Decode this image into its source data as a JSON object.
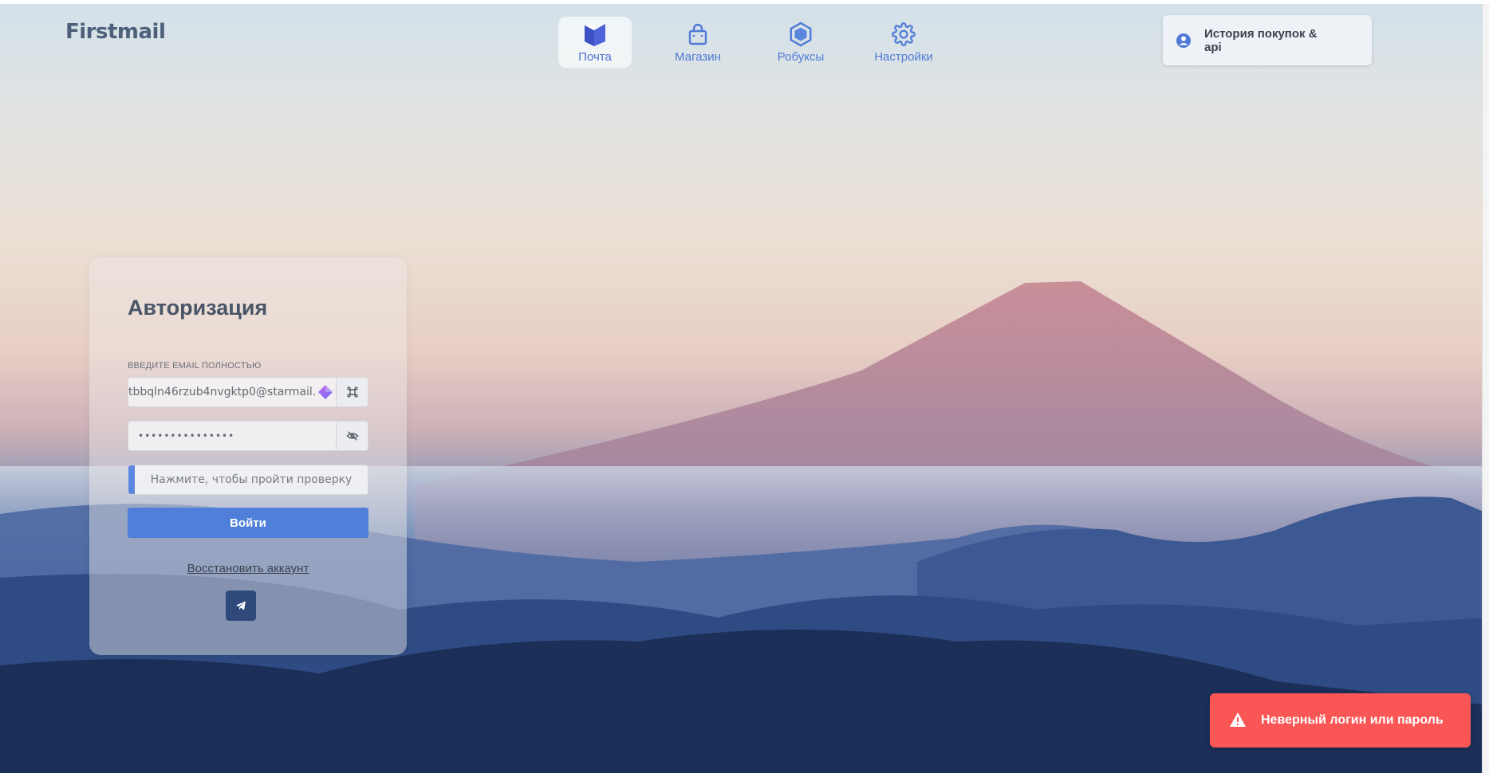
{
  "header": {
    "logo": "Firstmail",
    "nav": [
      {
        "label": "Почта",
        "icon": "mail-box-icon",
        "active": true
      },
      {
        "label": "Магазин",
        "icon": "shopping-bag-icon",
        "active": false
      },
      {
        "label": "Робуксы",
        "icon": "hexagon-icon",
        "active": false
      },
      {
        "label": "Настройки",
        "icon": "gear-icon",
        "active": false
      }
    ],
    "history_button": "История покупок & api"
  },
  "auth": {
    "title": "Авторизация",
    "email_label": "ВВЕДИТЕ EMAIL ПОЛНОСТЬЮ",
    "email_value": "tbbqln46rzub4nvgktp0@starmail.",
    "password_value": "•••••••••••••••",
    "captcha_text": "Нажмите, чтобы пройти проверку",
    "login_button": "Войти",
    "restore_link": "Восстановить аккаунт"
  },
  "toast": {
    "message": "Неверный логин или пароль",
    "color": "#fb5656"
  },
  "colors": {
    "accent": "#4f7fd8",
    "nav_text": "#4f7bd6"
  }
}
